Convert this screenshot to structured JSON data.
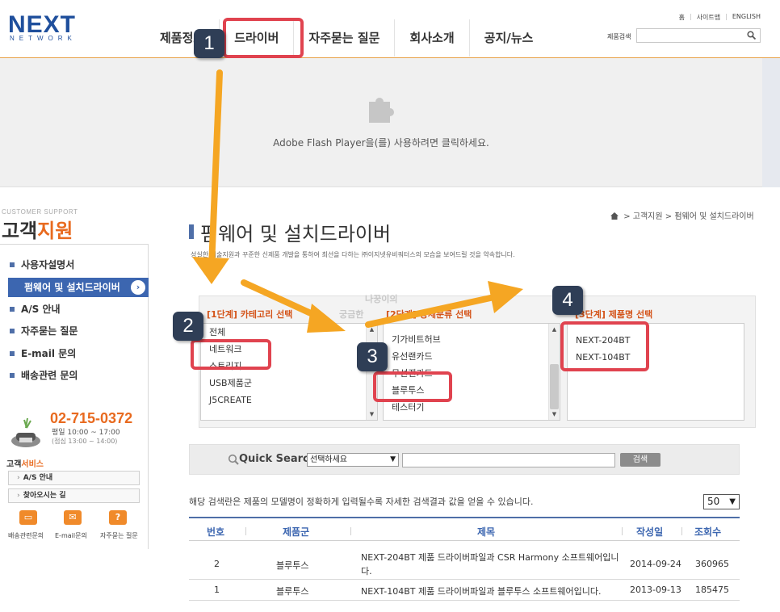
{
  "header": {
    "logo_main": "NEXT",
    "logo_sub": "NETWORK",
    "top_links": [
      "홈",
      "사이트맵",
      "ENGLISH"
    ],
    "nav": [
      "제품정보",
      "드라이버",
      "자주묻는 질문",
      "회사소개",
      "공지/뉴스"
    ],
    "search_label": "제품검색",
    "search_placeholder": ""
  },
  "flash": {
    "message": "Adobe Flash Player을(를) 사용하려면 클릭하세요."
  },
  "sidebar": {
    "small_title": "CUSTOMER SUPPORT",
    "title_plain": "고객",
    "title_accent": "지원",
    "items": [
      "사용자설명서",
      "펌웨어 및 설치드라이버",
      "A/S 안내",
      "자주묻는 질문",
      "E-mail 문의",
      "배송관련 문의"
    ],
    "active_chevron": "›",
    "phone": "02-715-0372",
    "hours": "평일 10:00 ~ 17:00",
    "lunch": "(점심 13:00 ~ 14:00)",
    "service_title_plain": "고객",
    "service_title_accent": "서비스",
    "service_buttons": [
      "A/S 안내",
      "찾아오시는 길"
    ],
    "quick_links": [
      "배송관련문의",
      "E-mail문의",
      "자주묻는 질문"
    ]
  },
  "breadcrumb": {
    "items": [
      "고객지원",
      "펌웨어 및 설치드라이버"
    ],
    "separator": ">"
  },
  "page": {
    "title": "펌웨어 및 설치드라이버",
    "description": "성실한 기술지원과 꾸준한 신제품 개발을 통하여 최선을 다하는 ㈜이지넷유비쿼터스의 모습을 보여드릴 것을 약속합니다."
  },
  "selector": {
    "step1_head": "[1단계] 카테고리 선택",
    "step2_head": "[2단계] 상세분류 선택",
    "step3_head": "[3단계] 제품명 선택",
    "ghost_1": "궁금한",
    "ghost_2": "나꿍이의",
    "categories": [
      "전체",
      "네트워크",
      "스토리지",
      "USB제품군",
      "J5CREATE"
    ],
    "subcategories": [
      "",
      "기가비트허브",
      "유선랜카드",
      "무선랜카드",
      "블루투스",
      "테스터기"
    ],
    "products": [
      "NEXT-204BT",
      "NEXT-104BT"
    ],
    "selected_category": "네트워크",
    "selected_subcategory": "블루투스"
  },
  "quick_search": {
    "label": "Quick Search",
    "select_value": "선택하세요",
    "input_value": "",
    "button": "검색"
  },
  "notice": "해당 검색란은 제품의 모델명이 정확하게 입력될수록 자세한 검색결과 값을 얻을 수 있습니다.",
  "page_size": "50",
  "table": {
    "headers": [
      "번호",
      "제품군",
      "제목",
      "작성일",
      "조회수"
    ],
    "rows": [
      {
        "no": "2",
        "group": "블루투스",
        "title": "NEXT-204BT 제품 드라이버파일과 CSR Harmony 소프트웨어입니다.",
        "date": "2014-09-24",
        "views": "360965"
      },
      {
        "no": "1",
        "group": "블루투스",
        "title": "NEXT-104BT 제품 드라이버파일과 블루투스 소프트웨어입니다.",
        "date": "2013-09-13",
        "views": "185475"
      }
    ]
  },
  "annotations": {
    "badges": [
      "1",
      "2",
      "3",
      "4"
    ],
    "color": "#e0434f",
    "arrow_color": "#f5a623"
  },
  "colors": {
    "brand_blue": "#1f4f9c",
    "accent_orange": "#e86a1f",
    "sidebar_active": "#3c66b0"
  }
}
